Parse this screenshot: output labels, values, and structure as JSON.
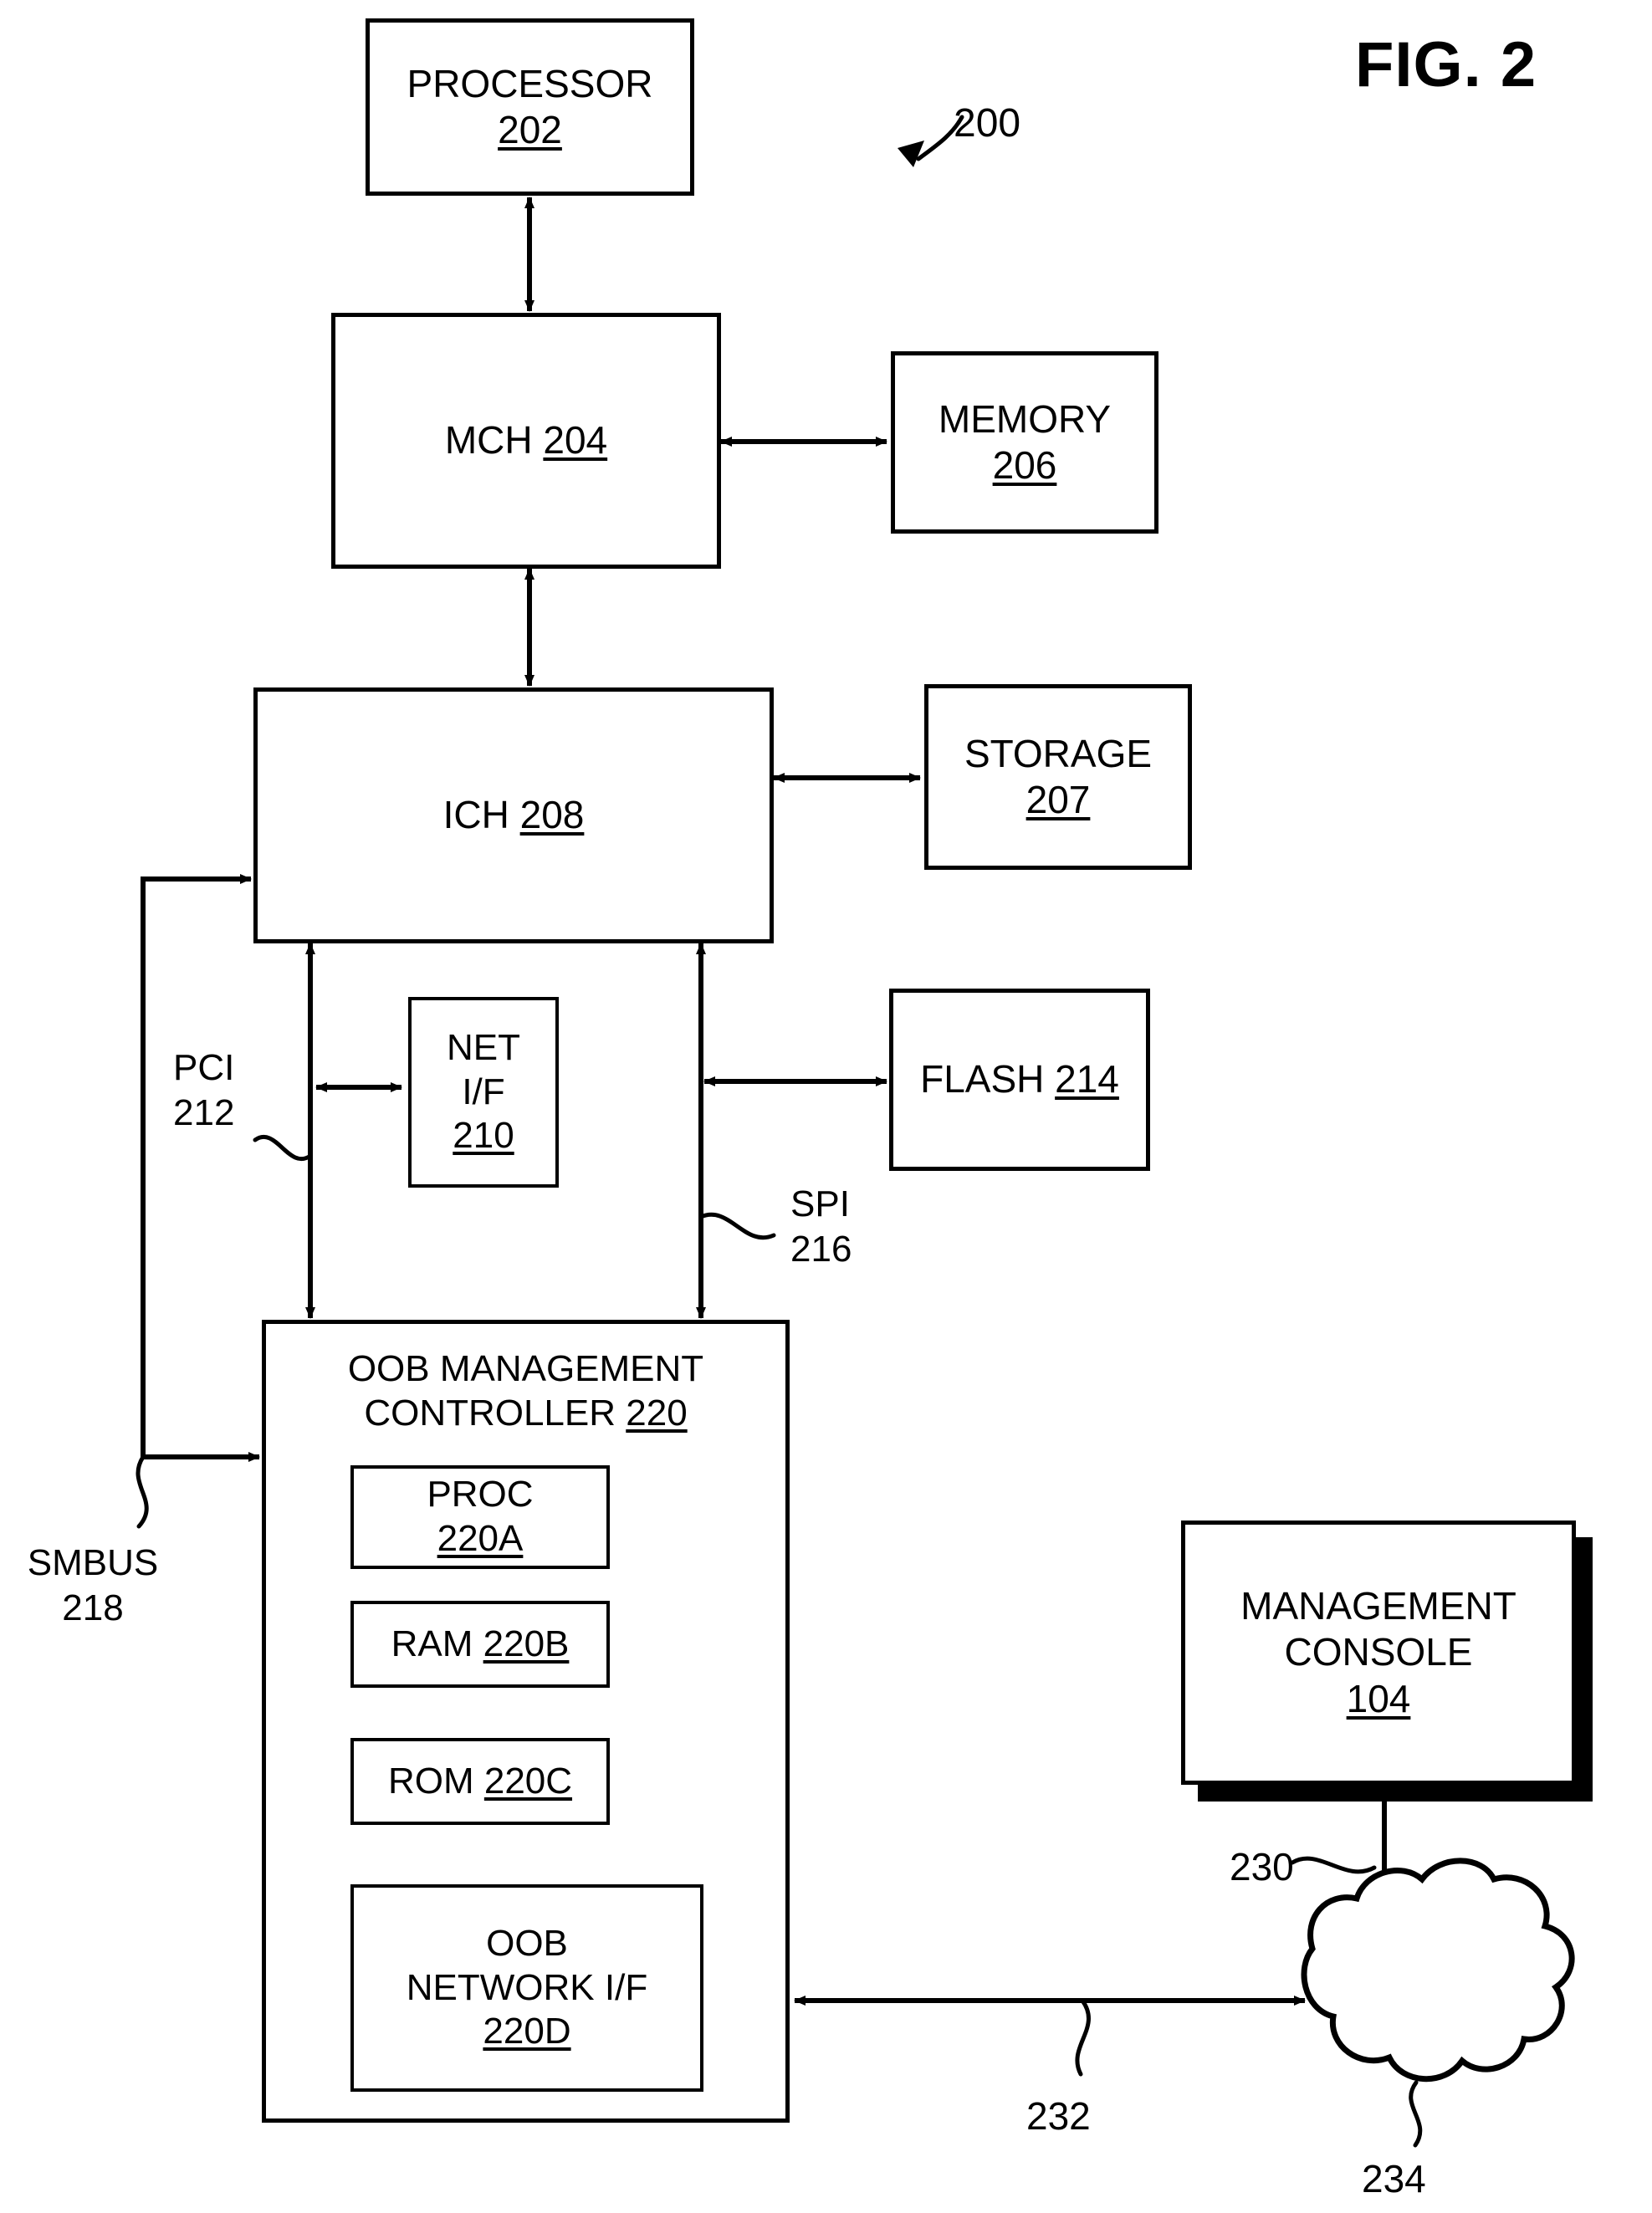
{
  "figure": {
    "title": "FIG. 2",
    "system_ref": "200"
  },
  "blocks": {
    "processor": {
      "label": "PROCESSOR",
      "ref": "202"
    },
    "mch": {
      "label": "MCH",
      "ref": "204"
    },
    "memory": {
      "label": "MEMORY",
      "ref": "206"
    },
    "ich": {
      "label": "ICH",
      "ref": "208"
    },
    "storage": {
      "label": "STORAGE",
      "ref": "207"
    },
    "net_if": {
      "label_line1": "NET",
      "label_line2": "I/F",
      "ref": "210"
    },
    "flash": {
      "label": "FLASH",
      "ref": "214"
    },
    "oob_controller": {
      "label_line1": "OOB MANAGEMENT",
      "label_line2": "CONTROLLER",
      "ref": "220"
    },
    "proc": {
      "label": "PROC",
      "ref": "220A"
    },
    "ram": {
      "label": "RAM",
      "ref": "220B"
    },
    "rom": {
      "label": "ROM",
      "ref": "220C"
    },
    "oob_net_if": {
      "label_line1": "OOB",
      "label_line2": "NETWORK I/F",
      "ref": "220D"
    },
    "management_console": {
      "label_line1": "MANAGEMENT",
      "label_line2": "CONSOLE",
      "ref": "104"
    }
  },
  "bus_labels": {
    "pci": {
      "name": "PCI",
      "ref": "212"
    },
    "spi": {
      "name": "SPI",
      "ref": "216"
    },
    "smbus": {
      "name": "SMBUS",
      "ref": "218"
    }
  },
  "link_refs": {
    "console_to_network": "230",
    "oob_to_network": "232",
    "network_cloud": "234"
  }
}
